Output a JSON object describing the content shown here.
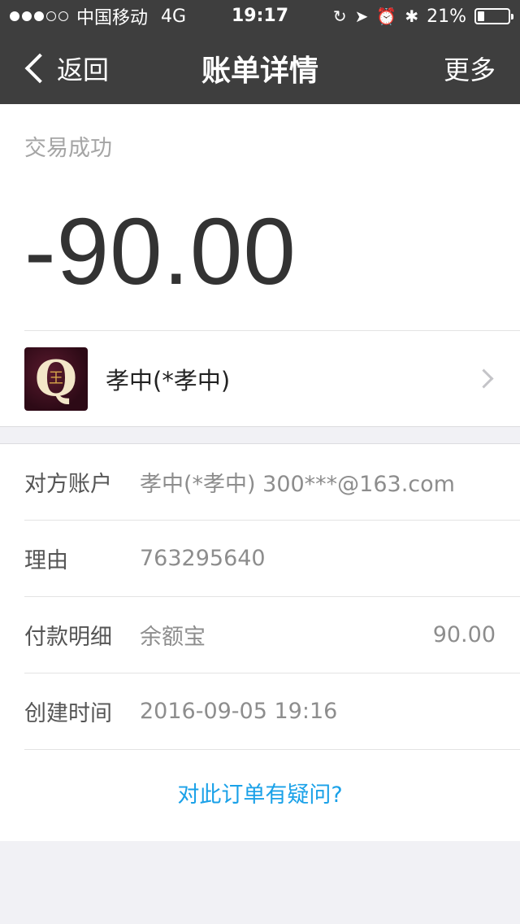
{
  "status_bar": {
    "carrier": "中国移动",
    "network": "4G",
    "time": "19:17",
    "battery_percent": "21%",
    "battery_level": 0.21
  },
  "nav": {
    "back_label": "返回",
    "title": "账单详情",
    "more_label": "更多"
  },
  "transaction": {
    "status": "交易成功",
    "amount": "-90.00"
  },
  "party": {
    "name": "孝中(*孝中)",
    "avatar_letter": "Q",
    "avatar_mark": "王"
  },
  "details": {
    "rows": [
      {
        "label": "对方账户",
        "value": "孝中(*孝中) 300***@163.com",
        "right": ""
      },
      {
        "label": "理由",
        "value": "763295640",
        "right": ""
      },
      {
        "label": "付款明细",
        "value": "余额宝",
        "right": "90.00"
      },
      {
        "label": "创建时间",
        "value": "2016-09-05 19:16",
        "right": ""
      }
    ],
    "question_link": "对此订单有疑问?"
  },
  "colors": {
    "header_bg": "#3e3e3e",
    "link": "#1aa1e8",
    "page_bg": "#f1f1f5"
  }
}
